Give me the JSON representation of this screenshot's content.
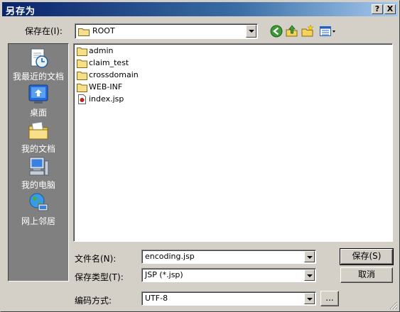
{
  "window": {
    "title": "另存为",
    "help_btn": "?",
    "close_btn": "X"
  },
  "look_in": {
    "label": "保存在(I):",
    "value": "ROOT"
  },
  "toolbar": {
    "icons": [
      "back-icon",
      "up-folder-icon",
      "new-folder-icon",
      "view-menu-icon"
    ]
  },
  "places": [
    {
      "label": "我最近的文档",
      "icon": "recent-documents-icon"
    },
    {
      "label": "桌面",
      "icon": "desktop-icon"
    },
    {
      "label": "我的文档",
      "icon": "my-documents-icon"
    },
    {
      "label": "我的电脑",
      "icon": "my-computer-icon"
    },
    {
      "label": "网上邻居",
      "icon": "network-places-icon"
    }
  ],
  "files": [
    {
      "name": "admin",
      "type": "folder"
    },
    {
      "name": "claim_test",
      "type": "folder"
    },
    {
      "name": "crossdomain",
      "type": "folder"
    },
    {
      "name": "WEB-INF",
      "type": "folder"
    },
    {
      "name": "index.jsp",
      "type": "jsp"
    }
  ],
  "filename": {
    "label": "文件名(N):",
    "value": "encoding.jsp"
  },
  "filetype": {
    "label": "保存类型(T):",
    "value": "JSP (*.jsp)"
  },
  "encoding": {
    "label": "编码方式:",
    "value": "UTF-8",
    "browse_label": "..."
  },
  "buttons": {
    "save": "保存(S)",
    "cancel": "取消"
  }
}
